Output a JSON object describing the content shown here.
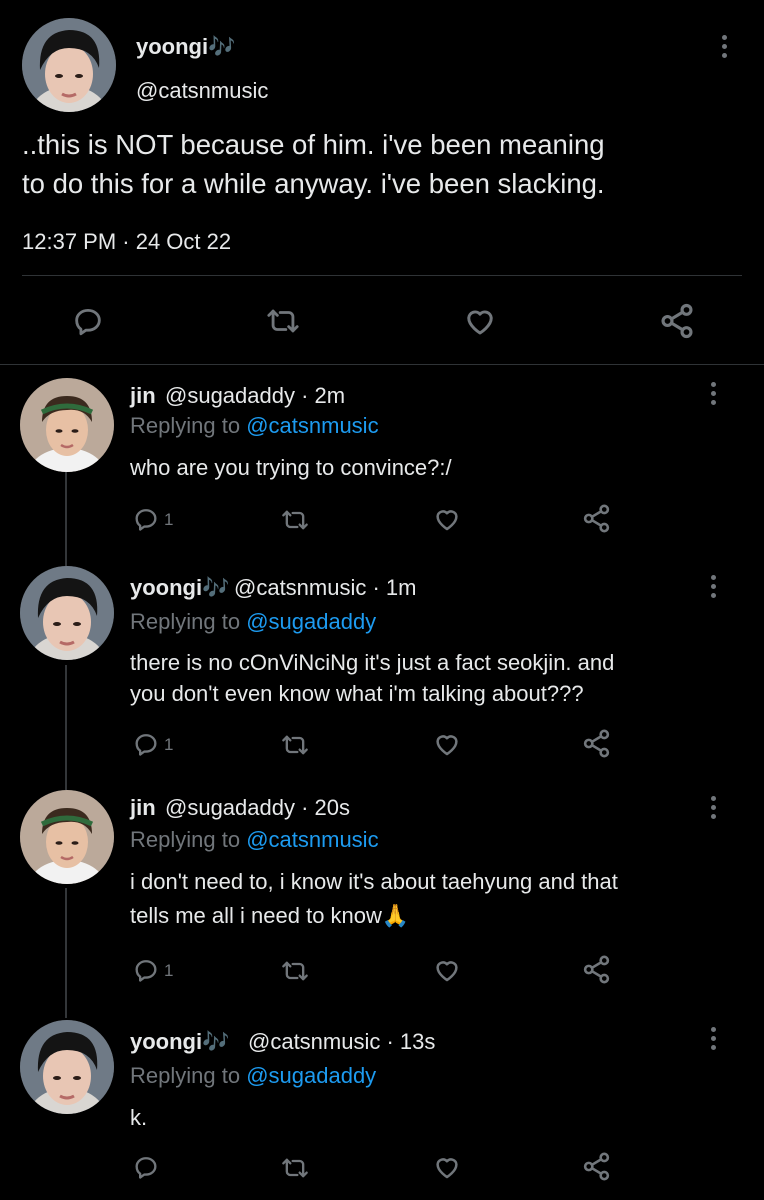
{
  "main_tweet": {
    "display_name": "yoongi🎶",
    "handle": "@catsnmusic",
    "text_line1": "..this is NOT because of him. i've been meaning",
    "text_line2": "to do this for a while anyway. i've been slacking.",
    "timestamp": "12:37 PM · 24 Oct 22",
    "actions": [
      "reply-icon",
      "retweet-icon",
      "like-icon",
      "share-icon"
    ]
  },
  "replies": [
    {
      "display_name": "jin",
      "handle_time": "@sugadaddy · 2m",
      "replying_prefix": "Replying to",
      "replying_handle": "@catsnmusic",
      "text_line1": "who are you trying to convince?:/",
      "text_line2": "",
      "reply_count": "1"
    },
    {
      "display_name": "yoongi🎶",
      "handle_time": "@catsnmusic · 1m",
      "replying_prefix": "Replying to",
      "replying_handle": "@sugadaddy",
      "text_line1": "there is no cOnViNciNg it's just a fact seokjin. and",
      "text_line2": "you don't even know what i'm talking about???",
      "reply_count": "1"
    },
    {
      "display_name": "jin",
      "handle_time": "@sugadaddy · 20s",
      "replying_prefix": "Replying to",
      "replying_handle": "@catsnmusic",
      "text_line1": "i don't need to, i know it's about taehyung and that",
      "text_line2": "tells me all i need to know🙏",
      "reply_count": "1"
    },
    {
      "display_name": "yoongi🎶",
      "handle_time": "@catsnmusic · 13s",
      "replying_prefix": "Replying to",
      "replying_handle": "@sugadaddy",
      "text_line1": "k.",
      "text_line2": "",
      "reply_count": ""
    }
  ],
  "colors": {
    "background": "#000000",
    "text": "#e7e9ea",
    "muted": "#71767b",
    "link": "#1d9bf0",
    "divider": "#2f3336"
  }
}
